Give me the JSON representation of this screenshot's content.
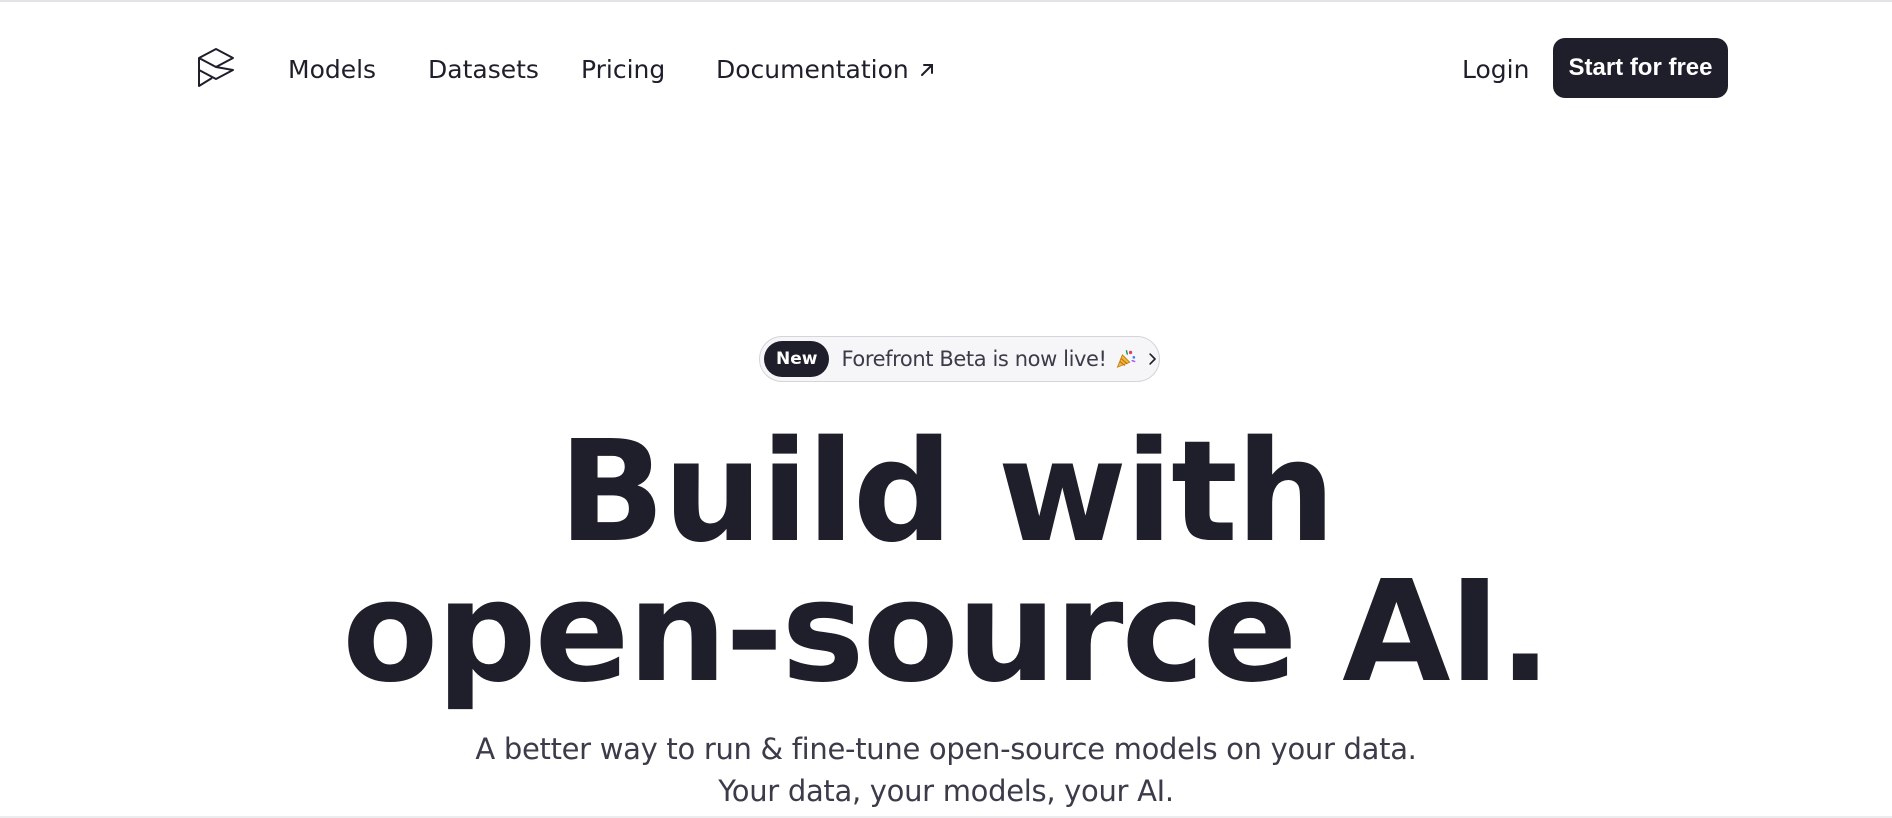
{
  "nav": {
    "links": [
      {
        "label": "Models"
      },
      {
        "label": "Datasets"
      },
      {
        "label": "Pricing"
      },
      {
        "label": "Documentation",
        "icon": "external-arrow-icon"
      }
    ],
    "login_label": "Login",
    "cta_label": "Start for free"
  },
  "announcement": {
    "badge": "New",
    "text": "Forefront Beta is now live!",
    "emoji_icon": "party-popper-icon",
    "chevron_icon": "chevron-right-icon"
  },
  "hero": {
    "headline_line1": "Build with",
    "headline_line2": "open-source AI.",
    "subtitle_line1": "A better way to run & fine-tune open-source models on your data.",
    "subtitle_line2": "Your data, your models, your AI."
  },
  "colors": {
    "primary_dark": "#1f1f2b",
    "text_muted": "#3b3b4a",
    "background": "#ffffff"
  }
}
